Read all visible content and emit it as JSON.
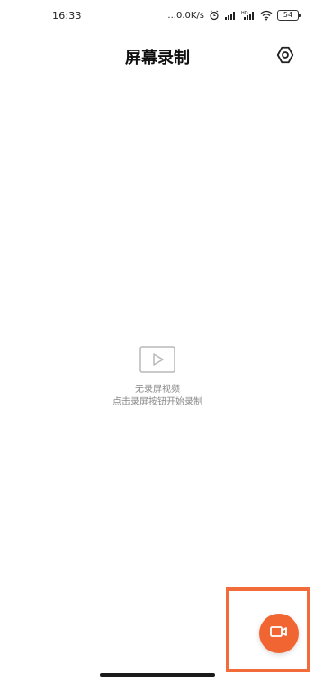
{
  "status_bar": {
    "time": "16:33",
    "dots": "...",
    "net_speed": "0.0K/s",
    "battery_level": "54",
    "icons": [
      "alarm-icon",
      "signal-1-icon",
      "signal-2-icon",
      "wifi-icon",
      "battery-icon"
    ]
  },
  "header": {
    "title": "屏幕录制",
    "settings_icon": "settings-icon"
  },
  "empty_state": {
    "icon": "video-play-icon",
    "line1": "无录屏视频",
    "line2": "点击录屏按钮开始录制"
  },
  "fab": {
    "icon": "video-camera-icon",
    "color": "#f06532",
    "highlight_color": "#f26b3a"
  },
  "nav": {
    "home_indicator": "home-indicator"
  }
}
